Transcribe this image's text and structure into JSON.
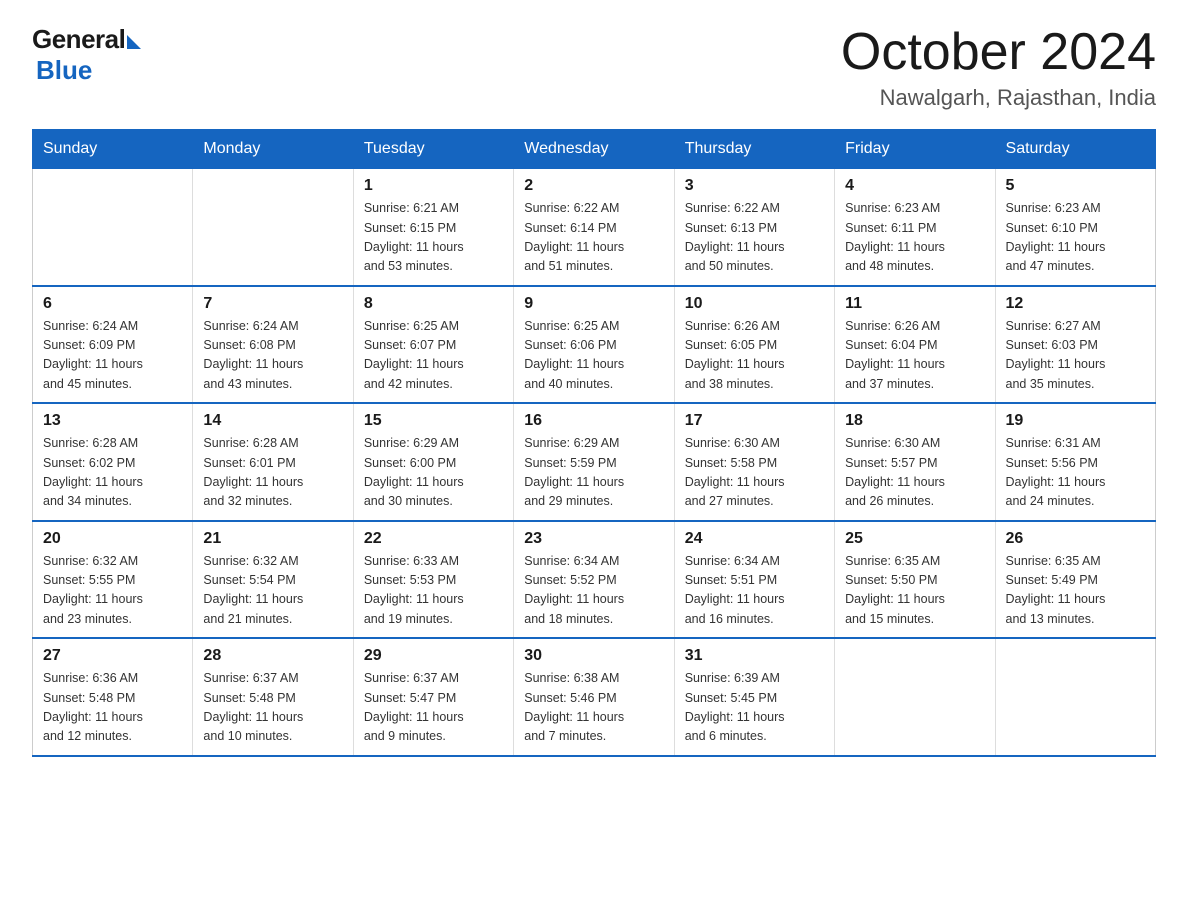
{
  "logo": {
    "general": "General",
    "blue": "Blue"
  },
  "title": {
    "month": "October 2024",
    "location": "Nawalgarh, Rajasthan, India"
  },
  "headers": [
    "Sunday",
    "Monday",
    "Tuesday",
    "Wednesday",
    "Thursday",
    "Friday",
    "Saturday"
  ],
  "weeks": [
    [
      {
        "day": "",
        "info": ""
      },
      {
        "day": "",
        "info": ""
      },
      {
        "day": "1",
        "info": "Sunrise: 6:21 AM\nSunset: 6:15 PM\nDaylight: 11 hours\nand 53 minutes."
      },
      {
        "day": "2",
        "info": "Sunrise: 6:22 AM\nSunset: 6:14 PM\nDaylight: 11 hours\nand 51 minutes."
      },
      {
        "day": "3",
        "info": "Sunrise: 6:22 AM\nSunset: 6:13 PM\nDaylight: 11 hours\nand 50 minutes."
      },
      {
        "day": "4",
        "info": "Sunrise: 6:23 AM\nSunset: 6:11 PM\nDaylight: 11 hours\nand 48 minutes."
      },
      {
        "day": "5",
        "info": "Sunrise: 6:23 AM\nSunset: 6:10 PM\nDaylight: 11 hours\nand 47 minutes."
      }
    ],
    [
      {
        "day": "6",
        "info": "Sunrise: 6:24 AM\nSunset: 6:09 PM\nDaylight: 11 hours\nand 45 minutes."
      },
      {
        "day": "7",
        "info": "Sunrise: 6:24 AM\nSunset: 6:08 PM\nDaylight: 11 hours\nand 43 minutes."
      },
      {
        "day": "8",
        "info": "Sunrise: 6:25 AM\nSunset: 6:07 PM\nDaylight: 11 hours\nand 42 minutes."
      },
      {
        "day": "9",
        "info": "Sunrise: 6:25 AM\nSunset: 6:06 PM\nDaylight: 11 hours\nand 40 minutes."
      },
      {
        "day": "10",
        "info": "Sunrise: 6:26 AM\nSunset: 6:05 PM\nDaylight: 11 hours\nand 38 minutes."
      },
      {
        "day": "11",
        "info": "Sunrise: 6:26 AM\nSunset: 6:04 PM\nDaylight: 11 hours\nand 37 minutes."
      },
      {
        "day": "12",
        "info": "Sunrise: 6:27 AM\nSunset: 6:03 PM\nDaylight: 11 hours\nand 35 minutes."
      }
    ],
    [
      {
        "day": "13",
        "info": "Sunrise: 6:28 AM\nSunset: 6:02 PM\nDaylight: 11 hours\nand 34 minutes."
      },
      {
        "day": "14",
        "info": "Sunrise: 6:28 AM\nSunset: 6:01 PM\nDaylight: 11 hours\nand 32 minutes."
      },
      {
        "day": "15",
        "info": "Sunrise: 6:29 AM\nSunset: 6:00 PM\nDaylight: 11 hours\nand 30 minutes."
      },
      {
        "day": "16",
        "info": "Sunrise: 6:29 AM\nSunset: 5:59 PM\nDaylight: 11 hours\nand 29 minutes."
      },
      {
        "day": "17",
        "info": "Sunrise: 6:30 AM\nSunset: 5:58 PM\nDaylight: 11 hours\nand 27 minutes."
      },
      {
        "day": "18",
        "info": "Sunrise: 6:30 AM\nSunset: 5:57 PM\nDaylight: 11 hours\nand 26 minutes."
      },
      {
        "day": "19",
        "info": "Sunrise: 6:31 AM\nSunset: 5:56 PM\nDaylight: 11 hours\nand 24 minutes."
      }
    ],
    [
      {
        "day": "20",
        "info": "Sunrise: 6:32 AM\nSunset: 5:55 PM\nDaylight: 11 hours\nand 23 minutes."
      },
      {
        "day": "21",
        "info": "Sunrise: 6:32 AM\nSunset: 5:54 PM\nDaylight: 11 hours\nand 21 minutes."
      },
      {
        "day": "22",
        "info": "Sunrise: 6:33 AM\nSunset: 5:53 PM\nDaylight: 11 hours\nand 19 minutes."
      },
      {
        "day": "23",
        "info": "Sunrise: 6:34 AM\nSunset: 5:52 PM\nDaylight: 11 hours\nand 18 minutes."
      },
      {
        "day": "24",
        "info": "Sunrise: 6:34 AM\nSunset: 5:51 PM\nDaylight: 11 hours\nand 16 minutes."
      },
      {
        "day": "25",
        "info": "Sunrise: 6:35 AM\nSunset: 5:50 PM\nDaylight: 11 hours\nand 15 minutes."
      },
      {
        "day": "26",
        "info": "Sunrise: 6:35 AM\nSunset: 5:49 PM\nDaylight: 11 hours\nand 13 minutes."
      }
    ],
    [
      {
        "day": "27",
        "info": "Sunrise: 6:36 AM\nSunset: 5:48 PM\nDaylight: 11 hours\nand 12 minutes."
      },
      {
        "day": "28",
        "info": "Sunrise: 6:37 AM\nSunset: 5:48 PM\nDaylight: 11 hours\nand 10 minutes."
      },
      {
        "day": "29",
        "info": "Sunrise: 6:37 AM\nSunset: 5:47 PM\nDaylight: 11 hours\nand 9 minutes."
      },
      {
        "day": "30",
        "info": "Sunrise: 6:38 AM\nSunset: 5:46 PM\nDaylight: 11 hours\nand 7 minutes."
      },
      {
        "day": "31",
        "info": "Sunrise: 6:39 AM\nSunset: 5:45 PM\nDaylight: 11 hours\nand 6 minutes."
      },
      {
        "day": "",
        "info": ""
      },
      {
        "day": "",
        "info": ""
      }
    ]
  ]
}
